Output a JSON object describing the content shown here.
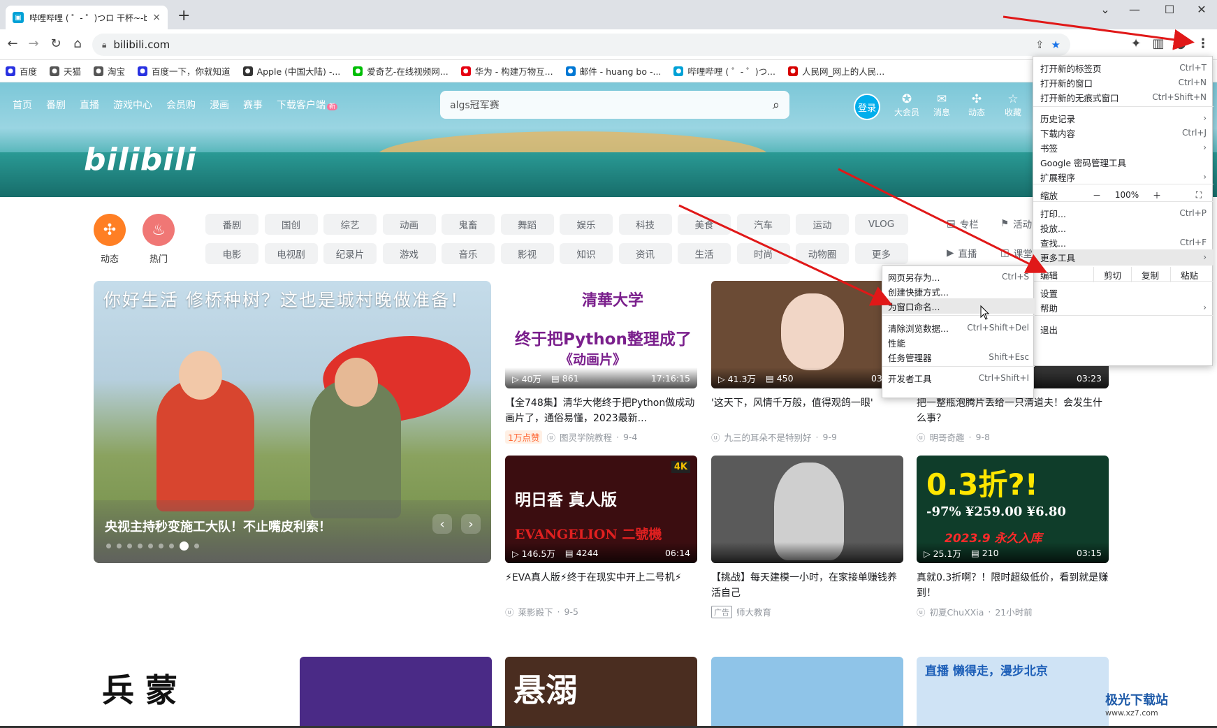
{
  "browser": {
    "tab_title": "哔哩哔哩 ( ゜- ゜)つロ 干杯~-bili",
    "tab_close": "×",
    "new_tab": "+",
    "url": "bilibili.com",
    "window": {
      "minimize": "—",
      "maximize": "☐",
      "close": "✕",
      "dropdown": "⌄"
    },
    "bookmarks": [
      {
        "label": "百度",
        "color": "#2932e1"
      },
      {
        "label": "天猫",
        "color": "#555555"
      },
      {
        "label": "淘宝",
        "color": "#555555"
      },
      {
        "label": "百度一下，你就知道",
        "color": "#2932e1"
      },
      {
        "label": "Apple (中国大陆) -...",
        "color": "#333333"
      },
      {
        "label": "爱奇艺-在线视频网...",
        "color": "#00be06"
      },
      {
        "label": "华为 - 构建万物互...",
        "color": "#e60012"
      },
      {
        "label": "邮件 - huang bo -...",
        "color": "#0078d4"
      },
      {
        "label": "哔哩哔哩 ( ゜- ゜)つ...",
        "color": "#00a1d6"
      },
      {
        "label": "人民网_网上的人民...",
        "color": "#d60000"
      }
    ]
  },
  "site": {
    "logo": "bilibili",
    "nav": [
      "首页",
      "番剧",
      "直播",
      "游戏中心",
      "会员购",
      "漫画",
      "赛事",
      "下载客户端"
    ],
    "nav_new_badge": "新",
    "search_placeholder": "algs冠军赛",
    "login": "登录",
    "right_nav": [
      {
        "icon": "✪",
        "label": "大会员"
      },
      {
        "icon": "✉",
        "label": "消息"
      },
      {
        "icon": "✣",
        "label": "动态"
      },
      {
        "icon": "☆",
        "label": "收藏"
      }
    ],
    "quick": [
      {
        "label": "动态",
        "icon": "✣",
        "color": "#ff7f24"
      },
      {
        "label": "热门",
        "icon": "♨",
        "color": "#f07775"
      }
    ],
    "channels_row1": [
      "番剧",
      "国创",
      "综艺",
      "动画",
      "鬼畜",
      "舞蹈",
      "娱乐",
      "科技",
      "美食",
      "汽车",
      "运动",
      "VLOG"
    ],
    "channels_row2": [
      "电影",
      "电视剧",
      "纪录片",
      "游戏",
      "音乐",
      "影视",
      "知识",
      "资讯",
      "生活",
      "时尚",
      "动物圈",
      "更多"
    ],
    "side_links": [
      {
        "icon": "▤",
        "label": "专栏"
      },
      {
        "icon": "⚑",
        "label": "活动"
      },
      {
        "icon": "▶",
        "label": "直播"
      },
      {
        "icon": "◫",
        "label": "课堂"
      }
    ],
    "carousel": {
      "title_text": "你好生活 修桥种树？这也是城村晚做准备！",
      "caption": "央视主持秒变施工大队！不止嘴皮利索！",
      "dots": 9,
      "active_dot": 7,
      "prev": "‹",
      "next": "›"
    },
    "videos": [
      {
        "views": "40万",
        "danmaku": "861",
        "duration": "17:16:15",
        "title": "【全748集】清华大佬终于把Python做成动画片了，通俗易懂，2023最新...",
        "tag": "1万点赞",
        "owner": "图灵学院教程",
        "date": "9-4",
        "thumb_text": "终于把Python整理成了",
        "thumb_sub": "《动画片》",
        "thumb_brand": "清華大学",
        "bg": "#ffffff",
        "thumb_color": "#7a1f8c"
      },
      {
        "views": "41.3万",
        "danmaku": "450",
        "duration": "03:23",
        "title": "'这天下，风情千万般，值得观鸽一眼'",
        "tag": "",
        "owner": "九三的耳朵不是特别好",
        "date": "9-9",
        "thumb_text": "",
        "thumb_sub": "",
        "thumb_brand": "",
        "bg": "#6b4b35",
        "thumb_color": "#ffffff"
      },
      {
        "views": "",
        "danmaku": "",
        "duration": "03:23",
        "title": "把一整瓶泡腾片丢给一只清道夫！会发生什么事？",
        "tag": "",
        "owner": "明哥奇趣",
        "date": "9-8",
        "thumb_text": "",
        "thumb_sub": "",
        "thumb_brand": "",
        "bg": "#3a3a3a",
        "thumb_color": "#ffffff"
      },
      {
        "views": "146.5万",
        "danmaku": "4244",
        "duration": "06:14",
        "title": "⚡EVA真人版⚡终于在现实中开上二号机⚡",
        "tag": "",
        "owner": "莱影殿下",
        "date": "9-5",
        "thumb_text": "明日香 真人版",
        "thumb_sub": "EVANGELION 二號機",
        "thumb_brand": "4K",
        "bg": "#3b0d10",
        "thumb_color": "#ffffff"
      },
      {
        "views": "",
        "danmaku": "",
        "duration": "",
        "title": "【挑战】每天建模一小时，在家接单赚钱养活自己",
        "tag": "",
        "owner": "师大教育",
        "date": "",
        "ad": "广告",
        "thumb_text": "",
        "thumb_sub": "",
        "thumb_brand": "",
        "bg": "#5a5a5a",
        "thumb_color": "#ffffff"
      },
      {
        "views": "25.1万",
        "danmaku": "210",
        "duration": "03:15",
        "title": "真就0.3折啊？！限时超级低价，看到就是赚到！",
        "tag": "",
        "owner": "初夏ChuXXia",
        "date": "21小时前",
        "thumb_text": "0.3折?!",
        "thumb_sub": "-97%   ¥259.00   ¥6.80",
        "thumb_brand": "2023.9 永久入库",
        "bg": "#0f3d2a",
        "thumb_color": "#ffe600"
      }
    ],
    "bottom_thumbs": [
      {
        "text": "兵  蒙",
        "bg": "#ffffff"
      },
      {
        "text": "",
        "bg": "#4a2a86"
      },
      {
        "text": "悬溺",
        "bg": "#4a2d20"
      },
      {
        "text": "",
        "bg": "#8fc4e8"
      },
      {
        "text": "直播  懒得走，漫步北京",
        "bg": "#cfe3f5"
      }
    ]
  },
  "chrome_menu": {
    "items": [
      {
        "label": "打开新的标签页",
        "key": "Ctrl+T"
      },
      {
        "label": "打开新的窗口",
        "key": "Ctrl+N"
      },
      {
        "label": "打开新的无痕式窗口",
        "key": "Ctrl+Shift+N"
      },
      {
        "label": "历史记录",
        "key": "›"
      },
      {
        "label": "下载内容",
        "key": "Ctrl+J"
      },
      {
        "label": "书签",
        "key": "›"
      },
      {
        "label": "Google 密码管理工具",
        "key": ""
      },
      {
        "label": "扩展程序",
        "key": "›"
      },
      {
        "label": "打印...",
        "key": "Ctrl+P"
      },
      {
        "label": "投放...",
        "key": ""
      },
      {
        "label": "查找...",
        "key": "Ctrl+F"
      },
      {
        "label": "更多工具",
        "key": "›"
      },
      {
        "label": "设置",
        "key": ""
      },
      {
        "label": "帮助",
        "key": "›"
      },
      {
        "label": "退出",
        "key": ""
      }
    ],
    "zoom": {
      "label": "缩放",
      "minus": "－",
      "value": "100%",
      "plus": "＋",
      "fullscreen": "⛶"
    },
    "edit": {
      "label": "编辑",
      "cut": "剪切",
      "copy": "复制",
      "paste": "粘贴"
    },
    "submenu": [
      {
        "label": "网页另存为...",
        "key": "Ctrl+S"
      },
      {
        "label": "创建快捷方式...",
        "key": ""
      },
      {
        "label": "为窗口命名...",
        "key": ""
      },
      {
        "label": "清除浏览数据...",
        "key": "Ctrl+Shift+Del"
      },
      {
        "label": "性能",
        "key": ""
      },
      {
        "label": "任务管理器",
        "key": "Shift+Esc"
      },
      {
        "label": "开发者工具",
        "key": "Ctrl+Shift+I"
      }
    ]
  },
  "watermark": {
    "name": "极光下载站",
    "url": "www.xz7.com"
  }
}
